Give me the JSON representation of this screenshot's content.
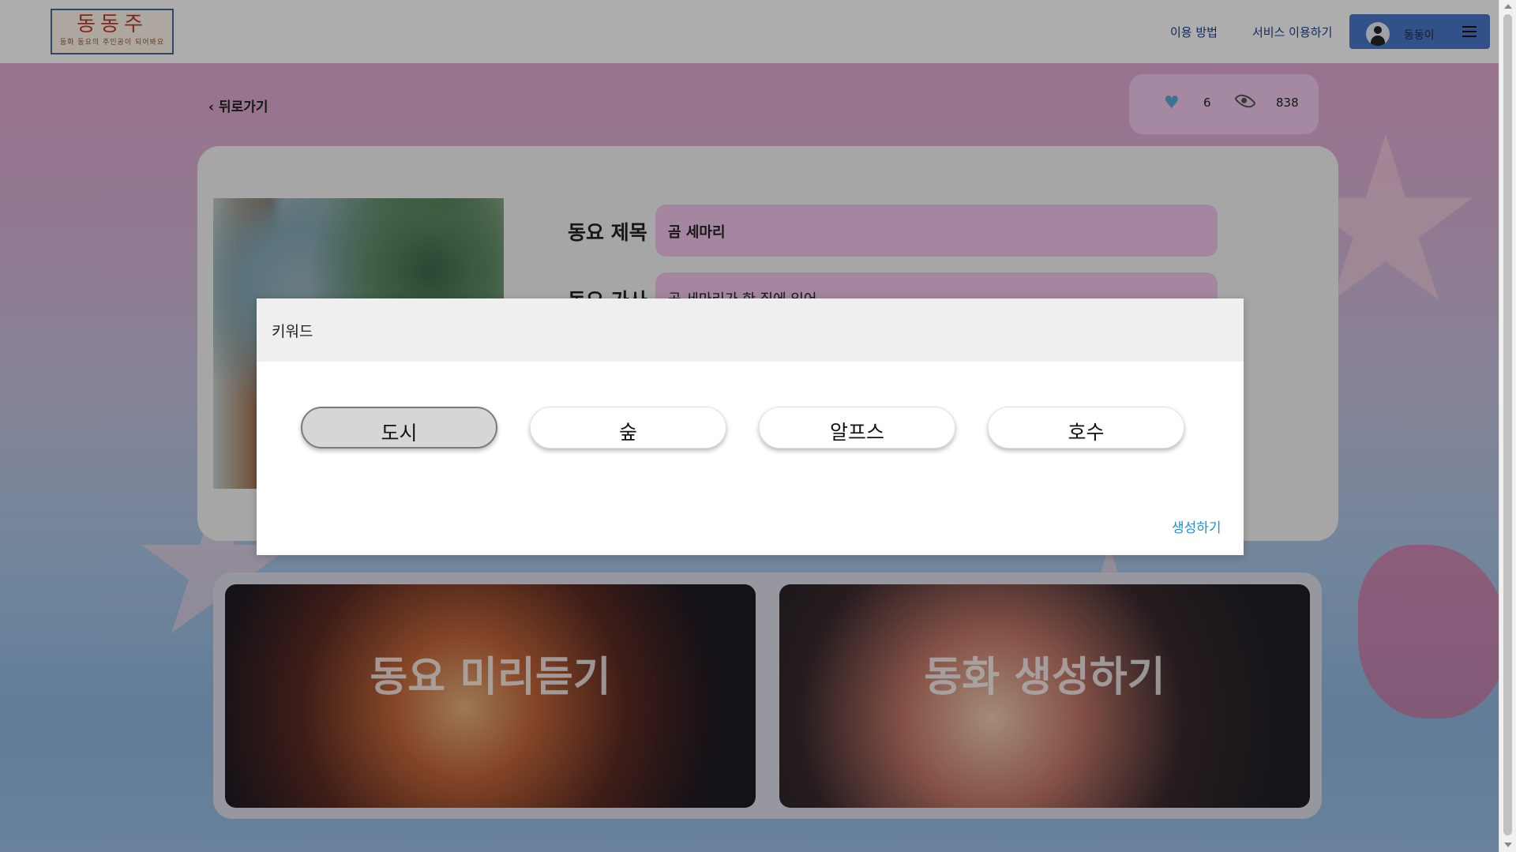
{
  "header": {
    "logo_title": "동동주",
    "logo_subtitle": "동화 동요의 주인공이 되어봐요",
    "nav": [
      "이용 방법",
      "서비스 이용하기"
    ],
    "user_name": "동동이"
  },
  "page": {
    "back_label": "뒤로가기",
    "likes": "6",
    "views": "838",
    "song": {
      "title_label": "동요 제목",
      "title_value": "곰 세마리",
      "lyrics_label": "동요 가사",
      "lyrics_value": "곰 세마리가 한 집에 있어"
    },
    "features": [
      "동요 미리듣기",
      "동화 생성하기"
    ]
  },
  "modal": {
    "title": "키워드",
    "keywords": [
      "도시",
      "숲",
      "알프스",
      "호수"
    ],
    "selected_keyword": "도시",
    "create_label": "생성하기"
  },
  "colors": {
    "accent_blue": "#4a78c9",
    "pink_field": "#f3c6ee",
    "link_blue": "#1e8fdc"
  }
}
